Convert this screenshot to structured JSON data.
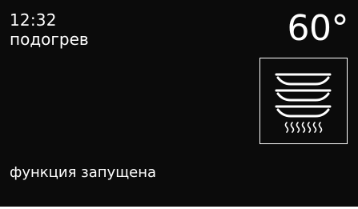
{
  "display": {
    "time": "12:32",
    "mode_name": "подогрев",
    "temperature": "60°",
    "status": "функция запущена",
    "mode_icon": "plates-warming-icon"
  },
  "colors": {
    "background": "#0b0b0b",
    "foreground": "#ffffff"
  }
}
